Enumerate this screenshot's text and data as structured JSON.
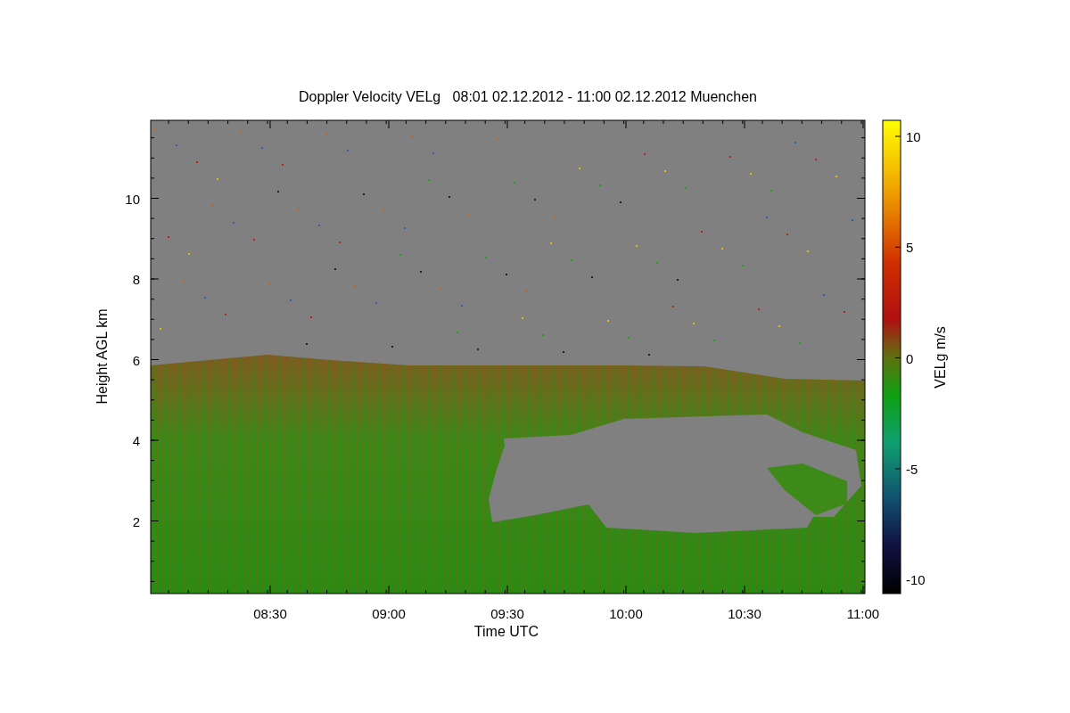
{
  "plot": {
    "title": "Doppler Velocity VELg   08:01 02.12.2012 - 11:00 02.12.2012 Muenchen",
    "xlabel": "Time UTC",
    "ylabel": "Height AGL km",
    "x_tick_labels": [
      "08:30",
      "09:00",
      "09:30",
      "10:00",
      "10:30",
      "11:00"
    ],
    "y_tick_labels": [
      "10",
      "8",
      "6",
      "4",
      "2"
    ],
    "colorbar": {
      "label": "VELg m/s",
      "tick_labels": [
        "10",
        "5",
        "0",
        "-5",
        "-10"
      ]
    }
  }
}
